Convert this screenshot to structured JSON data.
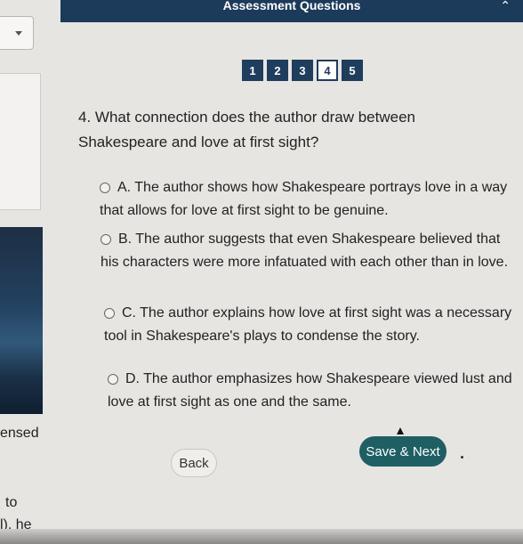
{
  "header": {
    "title": "Assessment Questions",
    "collapse_icon": "chevron-up-icon"
  },
  "left_fragments": {
    "line1": "ensed",
    "line2": "to",
    "line3": "l), he"
  },
  "nav": {
    "items": [
      {
        "label": "1",
        "current": false
      },
      {
        "label": "2",
        "current": false
      },
      {
        "label": "3",
        "current": false
      },
      {
        "label": "4",
        "current": true
      },
      {
        "label": "5",
        "current": false
      }
    ]
  },
  "question": {
    "number": "4.",
    "text": "What connection does the author draw between Shakespeare and love at first sight?"
  },
  "options": [
    {
      "label": "A. The author shows how Shakespeare portrays love in a way that allows for love at first sight to be genuine."
    },
    {
      "label": "B. The author suggests that even Shakespeare believed that his characters were more infatuated with each other than in love."
    },
    {
      "label": "C. The author explains how love at first sight was a necessary tool in Shakespeare's plays to condense the story."
    },
    {
      "label": "D. The author emphasizes how Shakespeare viewed lust and love at first sight as one and the same."
    }
  ],
  "buttons": {
    "back": "Back",
    "next": "Save & Next"
  },
  "colors": {
    "header": "#1c3a5a",
    "nav": "#1f3d5d",
    "primary_button": "#1f5f63"
  }
}
